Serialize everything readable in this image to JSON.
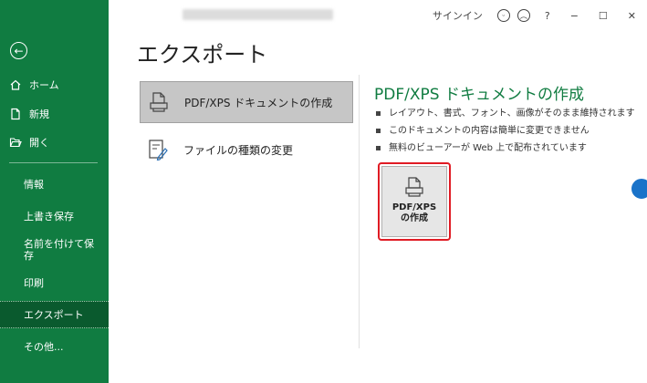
{
  "sidebar": {
    "top_items": [
      {
        "label": "ホーム",
        "icon": "home-icon"
      },
      {
        "label": "新規",
        "icon": "new-document-icon"
      },
      {
        "label": "開く",
        "icon": "open-folder-icon"
      }
    ],
    "sub_items": [
      {
        "label": "情報"
      },
      {
        "label": "上書き保存"
      },
      {
        "label": "名前を付けて保存"
      },
      {
        "label": "印刷"
      },
      {
        "label": "エクスポート"
      },
      {
        "label": "その他..."
      }
    ],
    "selected": "エクスポート"
  },
  "titlebar": {
    "signin": "サインイン",
    "help": "?",
    "minimize": "−",
    "maximize": "☐",
    "close": "✕"
  },
  "main": {
    "title": "エクスポート",
    "options": [
      {
        "label": "PDF/XPS ドキュメントの作成",
        "icon": "pdf-document-icon",
        "selected": true
      },
      {
        "label": "ファイルの種類の変更",
        "icon": "change-file-type-icon",
        "selected": false
      }
    ]
  },
  "detail": {
    "title": "PDF/XPS ドキュメントの作成",
    "bullets": [
      "レイアウト、書式、フォント、画像がそのまま維持されます",
      "このドキュメントの内容は簡単に変更できません",
      "無料のビューアーが Web 上で配布されています"
    ],
    "button_line1": "PDF/XPS",
    "button_line2": "の作成"
  },
  "colors": {
    "sidebar": "#107c41",
    "accent_title": "#107c41",
    "highlight_border": "#e01b24"
  }
}
